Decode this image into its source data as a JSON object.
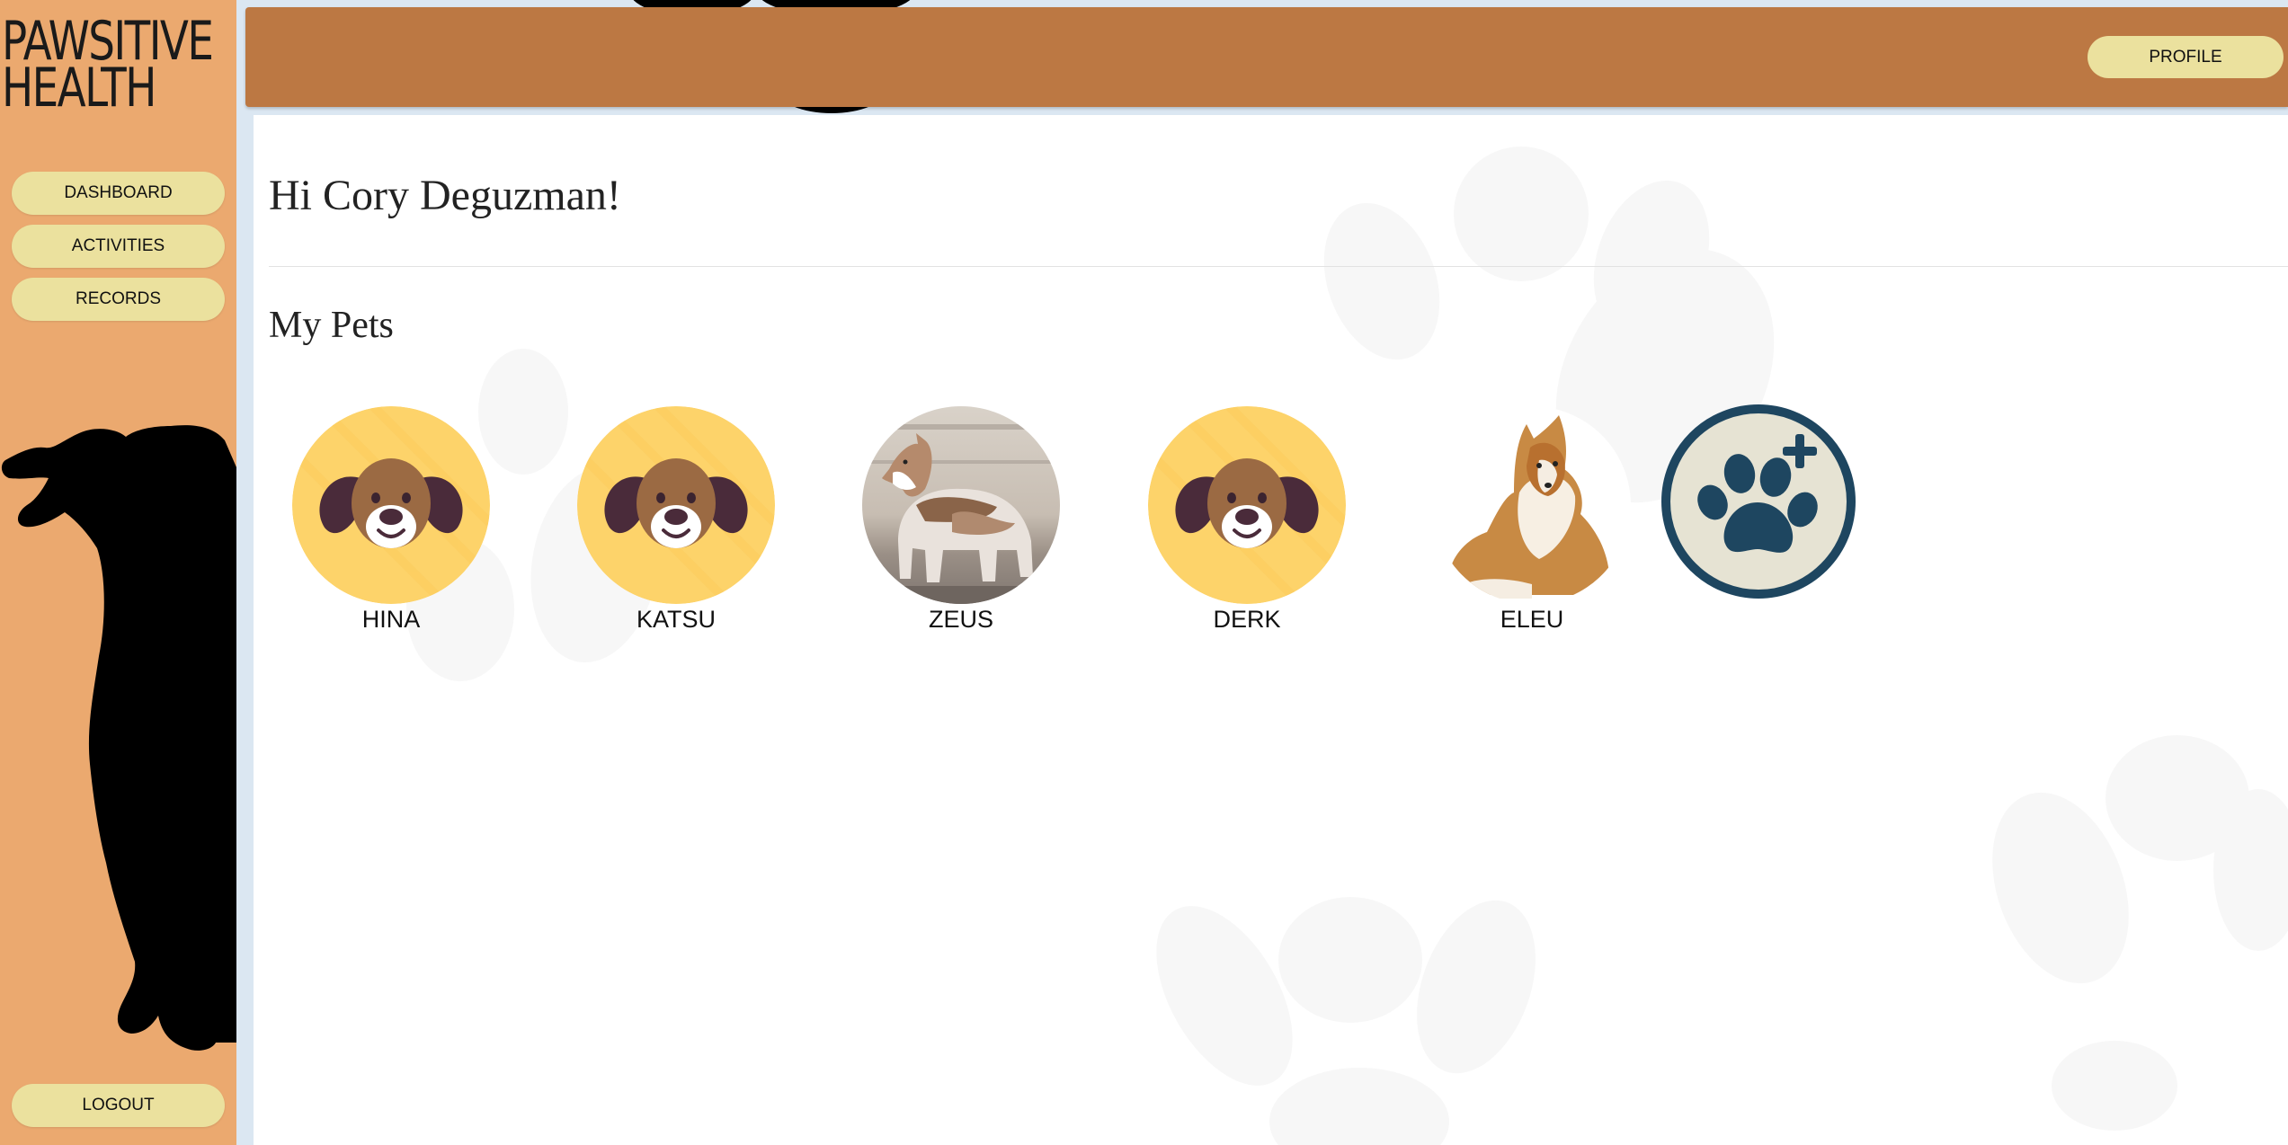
{
  "app": {
    "logo_line1": "PAWSITIVE",
    "logo_line2": "HEALTH"
  },
  "sidebar": {
    "items": [
      {
        "label": "DASHBOARD"
      },
      {
        "label": "ACTIVITIES"
      },
      {
        "label": "RECORDS"
      }
    ],
    "logout_label": "LOGOUT"
  },
  "header": {
    "profile_label": "PROFILE"
  },
  "main": {
    "greeting": "Hi Cory Deguzman!",
    "section_title": "My Pets",
    "pets": [
      {
        "name": "HINA",
        "avatar": "cartoon-dog-icon"
      },
      {
        "name": "KATSU",
        "avatar": "cartoon-dog-icon"
      },
      {
        "name": "ZEUS",
        "avatar": "dog-photo"
      },
      {
        "name": "DERK",
        "avatar": "cartoon-dog-icon"
      },
      {
        "name": "ELEU",
        "avatar": "dog-photo"
      }
    ],
    "add_pet_icon": "paw-plus-icon"
  },
  "colors": {
    "sidebar_bg": "#eba96f",
    "topbar_bg": "#bc7843",
    "button_bg": "#ebe19e",
    "avatar_yellow": "#fdd36a",
    "add_pet_ring": "#1e4660",
    "add_pet_fill": "#e6e3d3"
  }
}
